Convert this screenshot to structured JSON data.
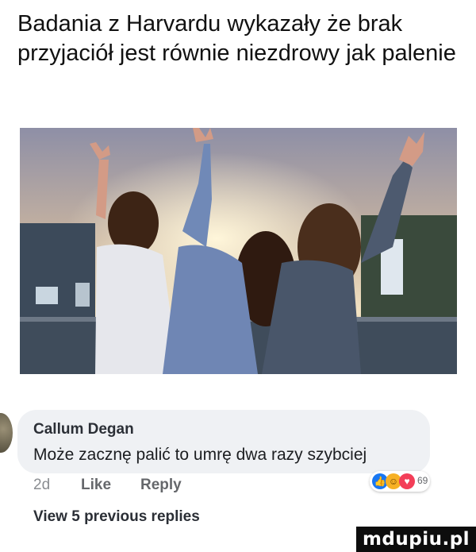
{
  "headline": "Badania z Harvardu wykazały że brak przyjaciół jest równie niezdrowy jak palenie",
  "comment": {
    "author": "Callum Degan",
    "text": "Może zacznę palić to umrę dwa razy szybciej",
    "time": "2d",
    "like_label": "Like",
    "reply_label": "Reply",
    "reactions": {
      "icons": [
        "like-icon",
        "haha-icon",
        "love-icon"
      ],
      "count": "69"
    }
  },
  "view_replies": "View 5 previous replies",
  "watermark": "mdupiu.pl",
  "colors": {
    "bubble": "#eff1f4",
    "like": "#1877f2",
    "haha": "#f7b125",
    "love": "#f33e58"
  }
}
